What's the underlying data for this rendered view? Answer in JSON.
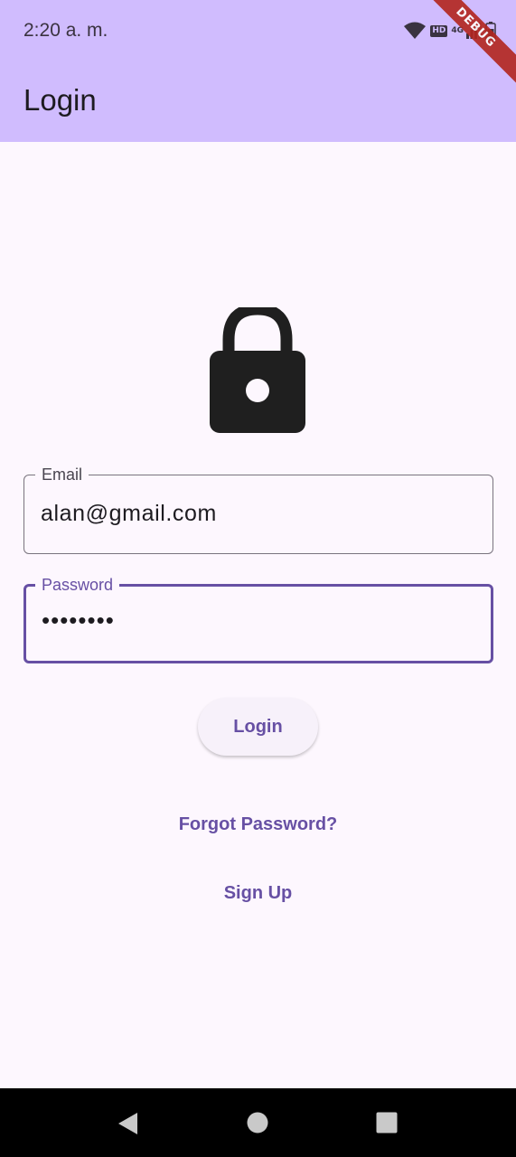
{
  "status_bar": {
    "time": "2:20 a. m.",
    "hd": "HD",
    "network": "4G"
  },
  "app_bar": {
    "title": "Login"
  },
  "debug_banner": "DEBUG",
  "form": {
    "email": {
      "label": "Email",
      "value": "alan@gmail.com"
    },
    "password": {
      "label": "Password",
      "value": "••••••••"
    }
  },
  "actions": {
    "login_label": "Login",
    "forgot_label": "Forgot Password?",
    "signup_label": "Sign Up"
  },
  "colors": {
    "app_bar": "#d0bcfe",
    "background": "#fdf7fe",
    "primary": "#6750a4",
    "outline": "#79747e"
  },
  "icons": {
    "status": [
      "wifi-icon",
      "signal-icon",
      "battery-icon"
    ],
    "main": "lock-icon",
    "nav": [
      "back-icon",
      "home-icon",
      "recents-icon"
    ]
  }
}
